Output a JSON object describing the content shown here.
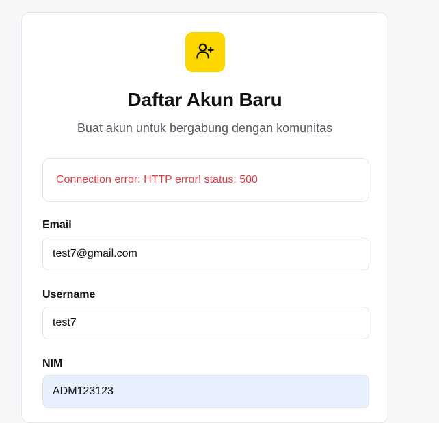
{
  "header": {
    "icon": "user-plus-icon",
    "title": "Daftar Akun Baru",
    "subtitle": "Buat akun untuk bergabung dengan komunitas"
  },
  "alert": {
    "message": "Connection error: HTTP error! status: 500",
    "color": "#e03a43"
  },
  "form": {
    "email": {
      "label": "Email",
      "value": "test7@gmail.com"
    },
    "username": {
      "label": "Username",
      "value": "test7"
    },
    "nim": {
      "label": "NIM",
      "value": "ADM123123"
    }
  },
  "colors": {
    "accent": "#fcd800",
    "autofill_background": "#e8f0fe"
  }
}
